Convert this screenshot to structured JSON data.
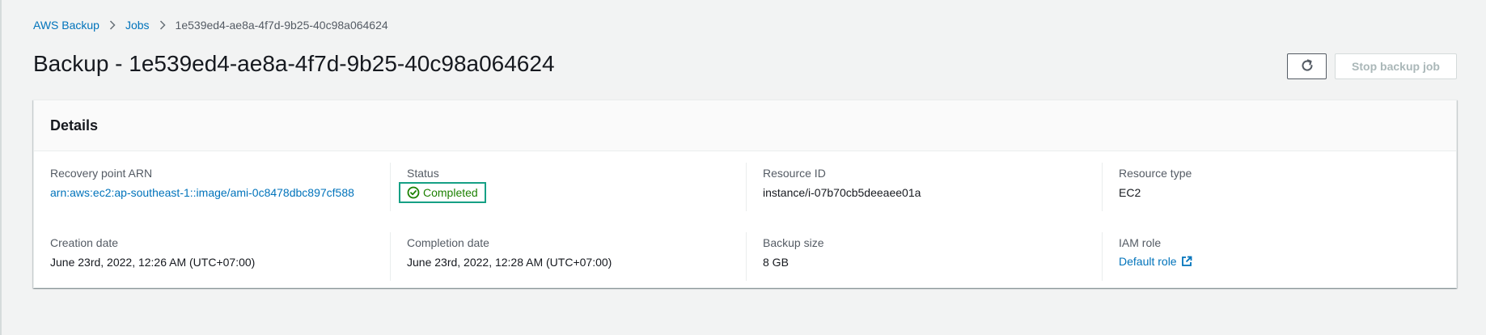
{
  "breadcrumb": {
    "items": [
      "AWS Backup",
      "Jobs"
    ],
    "current": "1e539ed4-ae8a-4f7d-9b25-40c98a064624"
  },
  "page": {
    "title": "Backup - 1e539ed4-ae8a-4f7d-9b25-40c98a064624"
  },
  "actions": {
    "refresh_icon": "refresh-icon",
    "stop_label": "Stop backup job"
  },
  "details": {
    "title": "Details",
    "recovery_point_arn": {
      "label": "Recovery point ARN",
      "value": "arn:aws:ec2:ap-southeast-1::image/ami-0c8478dbc897cf588"
    },
    "status": {
      "label": "Status",
      "value": "Completed",
      "icon": "check-circle-icon",
      "color": "#1d8102"
    },
    "resource_id": {
      "label": "Resource ID",
      "value": "instance/i-07b70cb5deeaee01a"
    },
    "resource_type": {
      "label": "Resource type",
      "value": "EC2"
    },
    "creation_date": {
      "label": "Creation date",
      "value": "June 23rd, 2022, 12:26 AM (UTC+07:00)"
    },
    "completion_date": {
      "label": "Completion date",
      "value": "June 23rd, 2022, 12:28 AM (UTC+07:00)"
    },
    "backup_size": {
      "label": "Backup size",
      "value": "8 GB"
    },
    "iam_role": {
      "label": "IAM role",
      "value": "Default role",
      "icon": "external-link-icon"
    }
  },
  "colors": {
    "link": "#0073bb",
    "success": "#1d8102",
    "background": "#f2f3f3"
  }
}
